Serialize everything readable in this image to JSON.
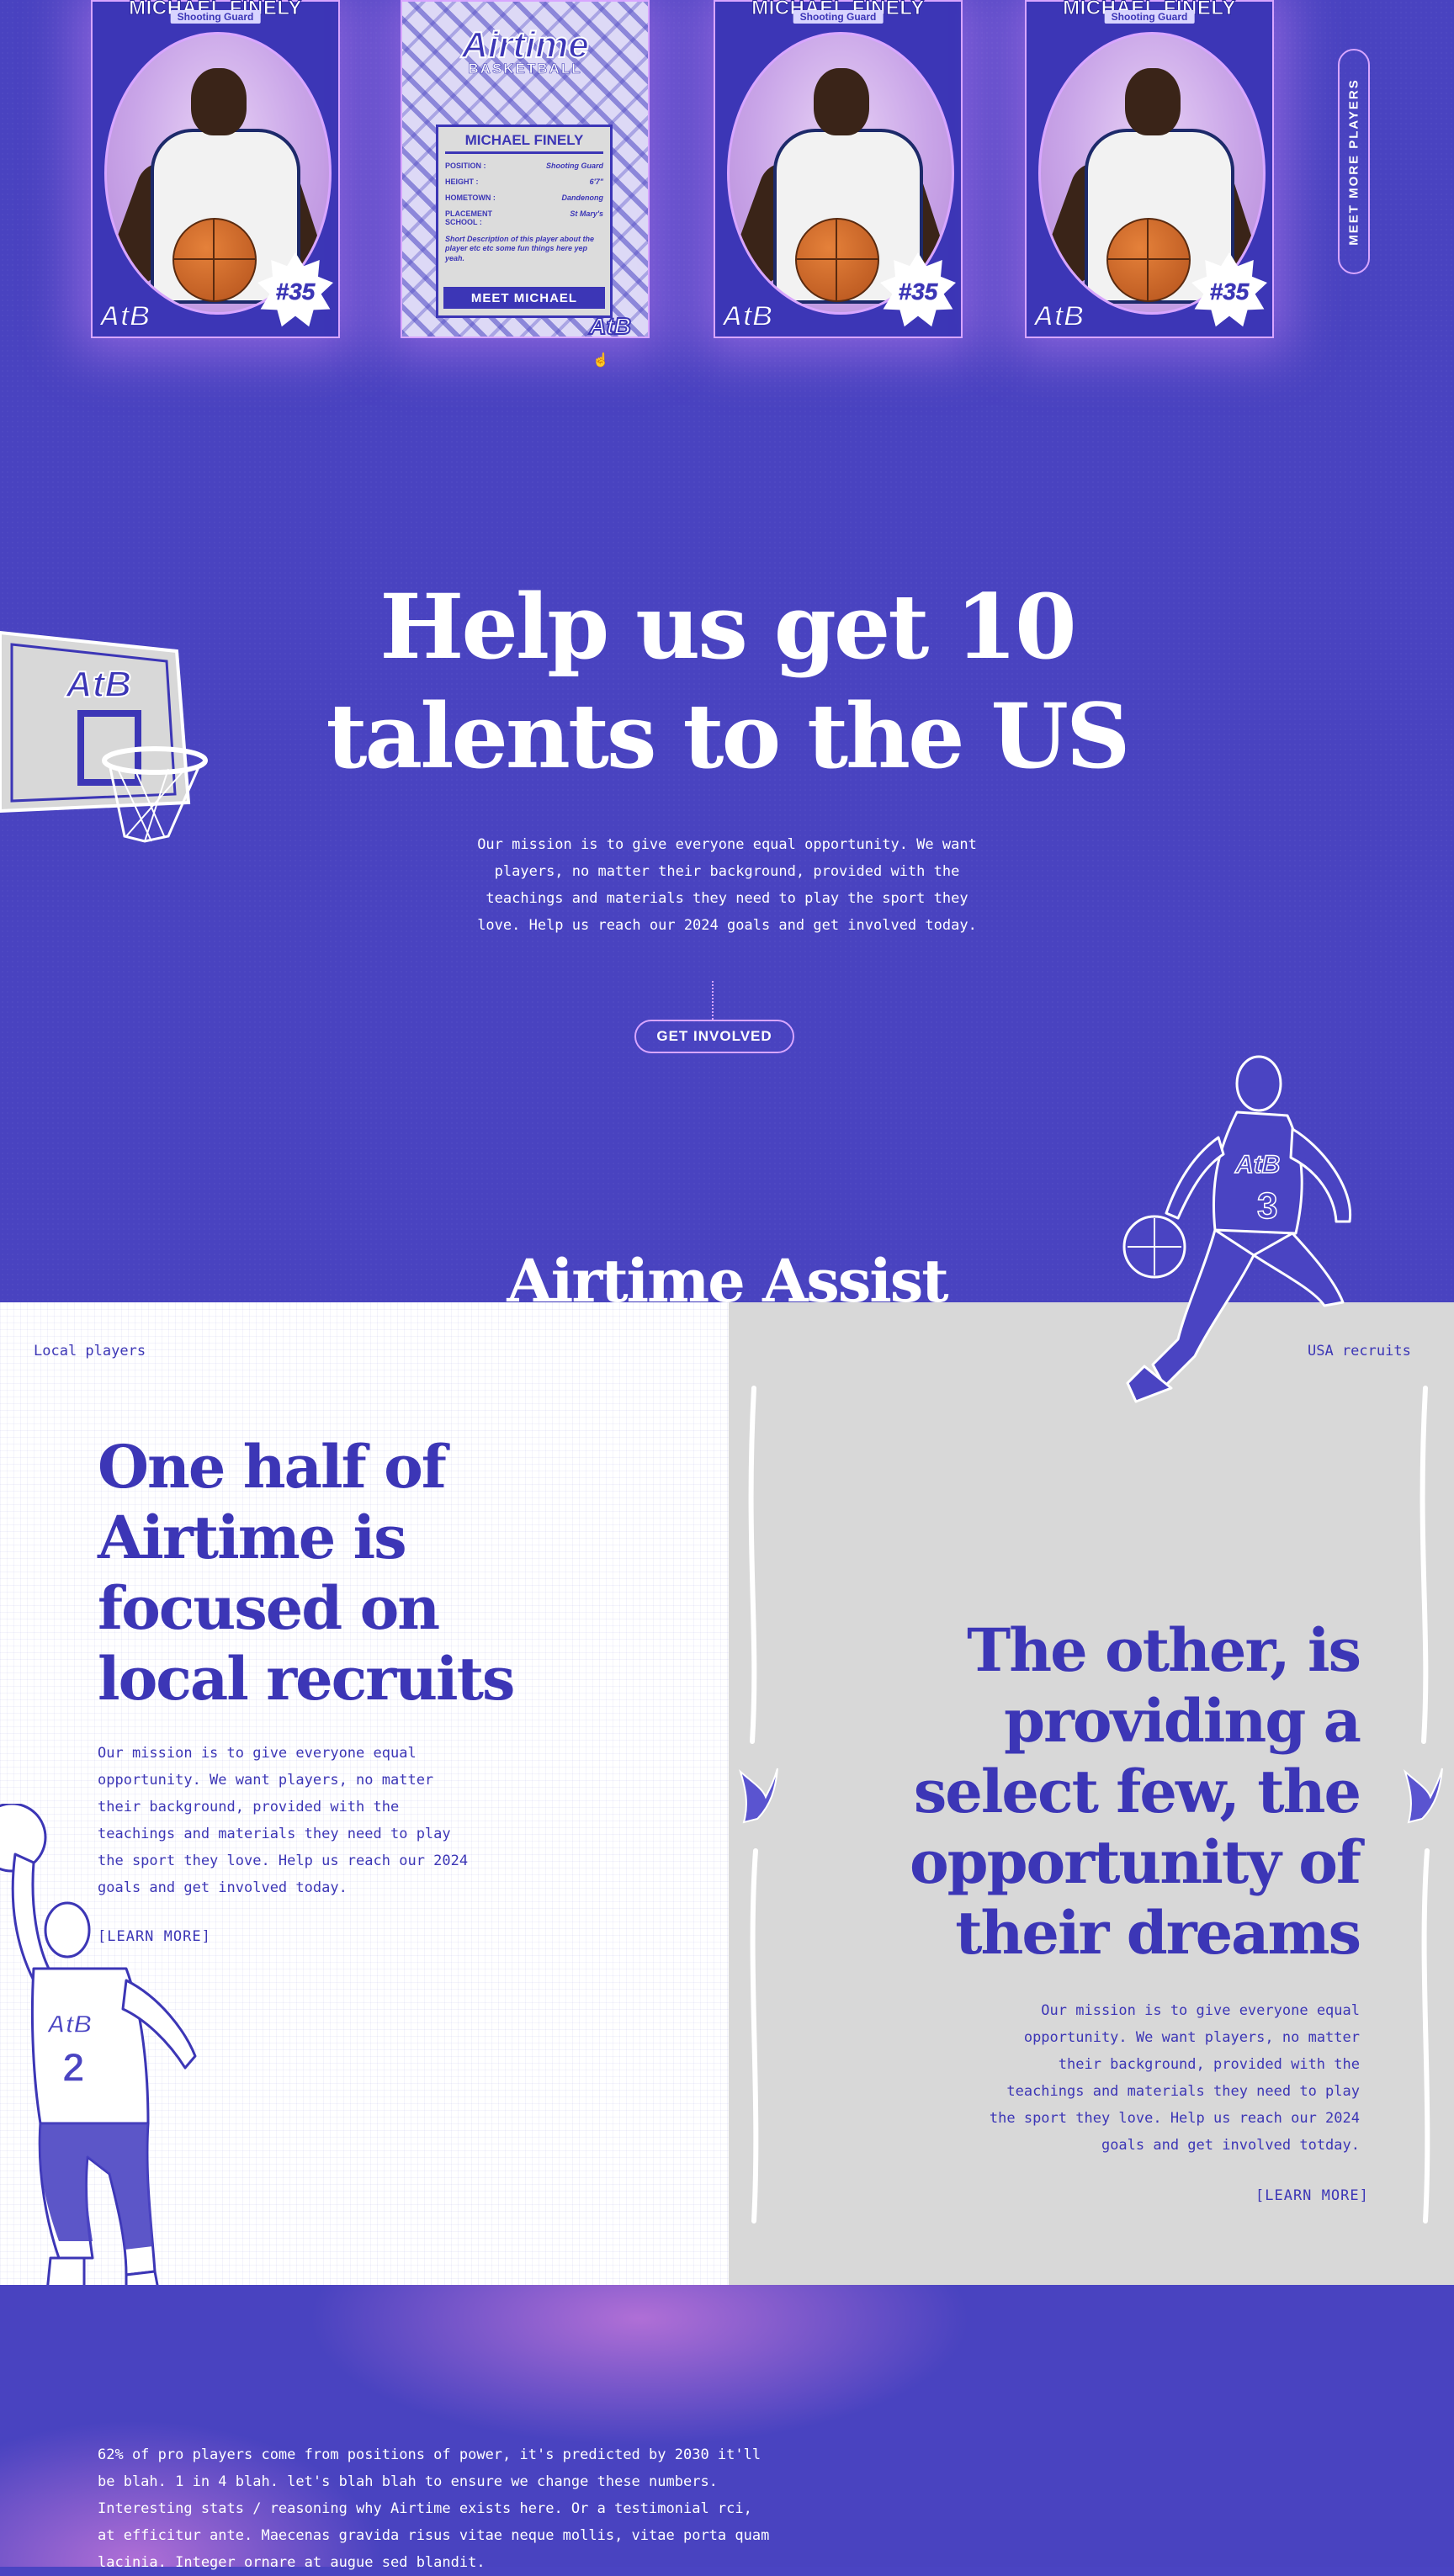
{
  "cards": [
    {
      "name": "MICHAEL FINELY",
      "position": "Shooting Guard",
      "number": "#35",
      "logo": "AtB"
    },
    {
      "name": "MICHAEL FINELY",
      "position": "Shooting Guard",
      "number": "#35",
      "logo": "AtB"
    },
    {
      "name": "MICHAEL FINELY",
      "position": "Shooting Guard",
      "number": "#35",
      "logo": "AtB"
    }
  ],
  "card_back": {
    "title": "Airtime",
    "subtitle": "BASKETBALL",
    "name": "MICHAEL FINELY",
    "stats": [
      {
        "label": "POSITION :",
        "value": "Shooting Guard"
      },
      {
        "label": "HEIGHT :",
        "value": "6'7\""
      },
      {
        "label": "HOMETOWN :",
        "value": "Dandenong"
      },
      {
        "label": "PLACEMENT SCHOOL :",
        "value": "St Mary's"
      }
    ],
    "description": "Short Description of this player about the player etc etc some fun things here yep yeah.",
    "button": "MEET MICHAEL",
    "logo": "AtB"
  },
  "meet_more": "MEET MORE PLAYERS",
  "hero": {
    "title_line1": "Help us get 10",
    "title_line2": "talents to the US",
    "body": "Our mission is to give everyone equal opportunity. We want players, no matter their background, provided with the teachings and materials they need to play the sport they love. Help us reach our 2024 goals and get involved today.",
    "cta": "GET INVOLVED"
  },
  "backboard_logo": "AtB",
  "assist_title": "Airtime Assist",
  "left": {
    "label": "Local players",
    "heading": "One half of Airtime is focused on local recruits",
    "body": "Our mission is to give everyone equal opportunity. We want players, no matter their background, provided with the teachings and materials they need to play the sport they love. Help us reach our 2024 goals and get involved today.",
    "link": "[LEARN MORE]"
  },
  "right": {
    "label": "USA recruits",
    "heading": "The other, is providing a select few, the opportunity of their dreams",
    "body": "Our mission is to give everyone equal opportunity. We want players, no matter their background, provided with the teachings and materials they need to play the sport they love. Help us reach our 2024 goals and get involved totday.",
    "link": "[LEARN MORE]"
  },
  "jersey": {
    "logo": "AtB",
    "number_a": "3",
    "number_b": "2"
  },
  "stats_text": "62% of pro players come from positions of power, it's predicted by 2030 it'll be blah. 1 in 4 blah. let's blah blah to ensure we change these numbers. Interesting stats / reasoning why Airtime exists here. Or a testimonial rci, at efficitur ante. Maecenas gravida risus vitae neque mollis, vitae porta quam lacinia. Integer ornare at augue sed blandit.",
  "colors": {
    "brand_blue": "#4943c0",
    "accent_purple": "#d8a6ff",
    "ink": "#3c36b6"
  }
}
